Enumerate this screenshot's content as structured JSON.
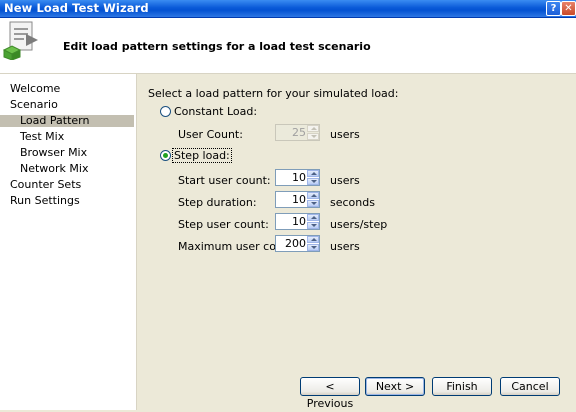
{
  "window": {
    "title": "New Load Test Wizard",
    "help_glyph": "?",
    "close_glyph": "✕"
  },
  "header": {
    "title": "Edit load pattern settings for a load test scenario",
    "icon": "wizard-document-icon"
  },
  "nav": {
    "items": [
      {
        "label": "Welcome"
      },
      {
        "label": "Scenario"
      },
      {
        "label": "Load Pattern",
        "selected": true
      },
      {
        "label": "Test Mix"
      },
      {
        "label": "Browser Mix"
      },
      {
        "label": "Network Mix"
      },
      {
        "label": "Counter Sets"
      },
      {
        "label": "Run Settings"
      }
    ]
  },
  "content": {
    "prompt": "Select a load pattern for your simulated load:",
    "constant": {
      "label": "Constant Load:",
      "selected": false,
      "user_count_label": "User Count:",
      "user_count_value": "25",
      "user_count_unit": "users"
    },
    "step": {
      "label": "Step load:",
      "selected": true,
      "fields": [
        {
          "label": "Start user count:",
          "value": "10",
          "unit": "users"
        },
        {
          "label": "Step duration:",
          "value": "10",
          "unit": "seconds"
        },
        {
          "label": "Step user count:",
          "value": "10",
          "unit": "users/step"
        },
        {
          "label": "Maximum user count:",
          "value": "200",
          "unit": "users"
        }
      ]
    }
  },
  "buttons": {
    "previous": "< Previous",
    "next": "Next >",
    "finish": "Finish",
    "cancel": "Cancel"
  }
}
